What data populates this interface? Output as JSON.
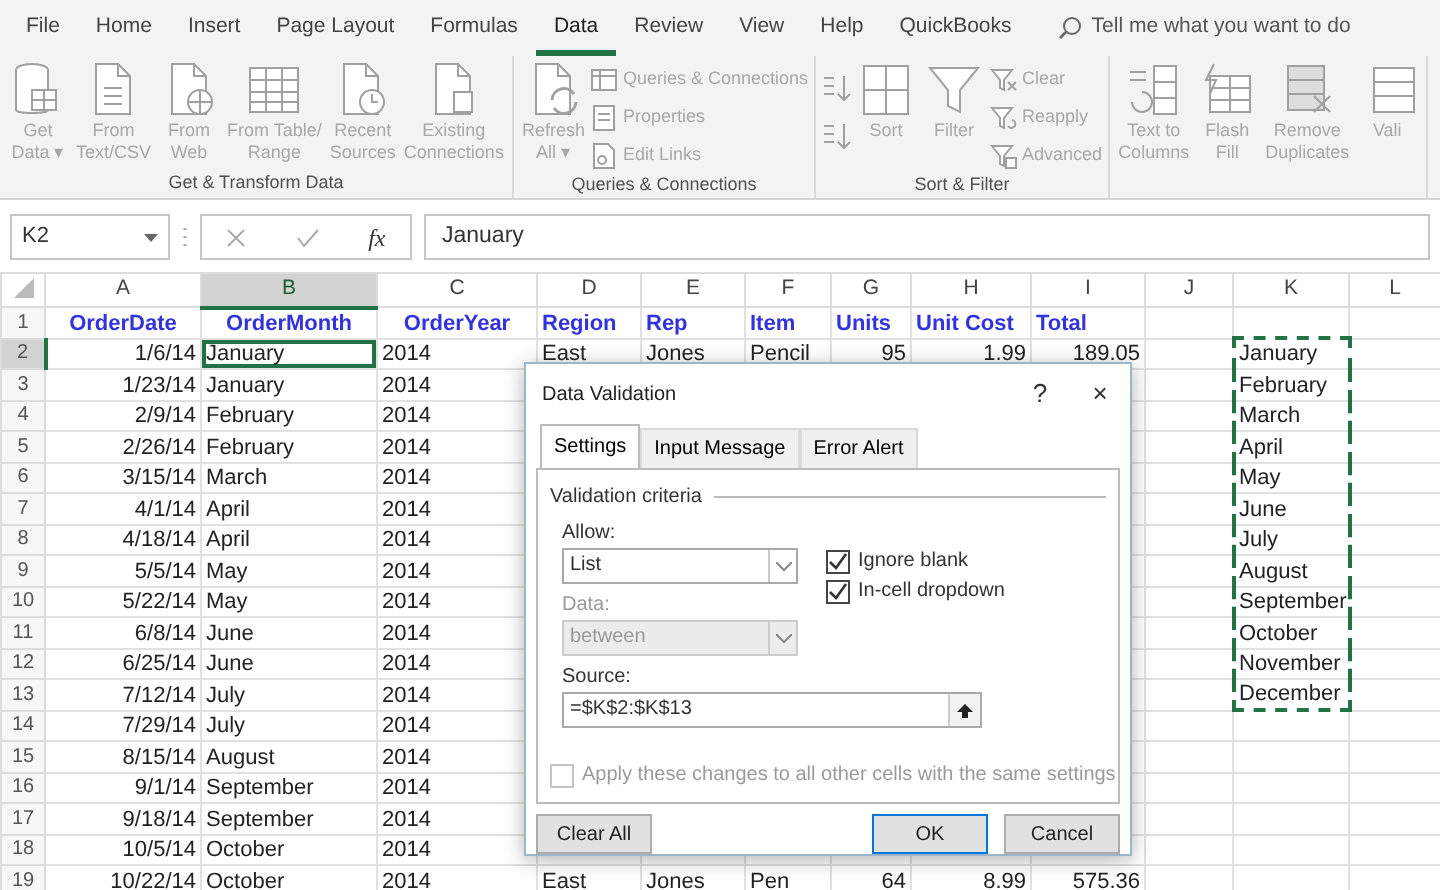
{
  "ribbon_tabs": [
    {
      "label": "File",
      "selected": false
    },
    {
      "label": "Home",
      "selected": false
    },
    {
      "label": "Insert",
      "selected": false
    },
    {
      "label": "Page Layout",
      "selected": false
    },
    {
      "label": "Formulas",
      "selected": false
    },
    {
      "label": "Data",
      "selected": true
    },
    {
      "label": "Review",
      "selected": false
    },
    {
      "label": "View",
      "selected": false
    },
    {
      "label": "Help",
      "selected": false
    },
    {
      "label": "QuickBooks",
      "selected": false
    }
  ],
  "tell_me": {
    "placeholder": "Tell me what you want to do"
  },
  "ribbon": {
    "disabled": true,
    "groups": [
      {
        "label": "Get & Transform Data",
        "items": [
          {
            "kind": "large",
            "lines": [
              "Get",
              "Data ▾"
            ]
          },
          {
            "kind": "large",
            "lines": [
              "From",
              "Text/CSV"
            ]
          },
          {
            "kind": "large",
            "lines": [
              "From",
              "Web"
            ]
          },
          {
            "kind": "large",
            "lines": [
              "From Table/",
              "Range"
            ]
          },
          {
            "kind": "large",
            "lines": [
              "Recent",
              "Sources"
            ]
          },
          {
            "kind": "large",
            "lines": [
              "Existing",
              "Connections"
            ]
          }
        ]
      },
      {
        "items": [
          {
            "kind": "large",
            "lines": [
              "Refresh",
              "All ▾"
            ]
          },
          {
            "kind": "small",
            "label": "Queries & Connections"
          },
          {
            "kind": "small",
            "label": "Properties"
          },
          {
            "kind": "small",
            "label": "Edit Links"
          }
        ],
        "label": "Queries & Connections"
      },
      {
        "label": "Sort & Filter",
        "items": [
          {
            "kind": "sort_icons"
          },
          {
            "kind": "large",
            "lines": [
              "Sort"
            ]
          },
          {
            "kind": "large",
            "lines": [
              "Filter"
            ]
          },
          {
            "kind": "small",
            "label": "Clear"
          },
          {
            "kind": "small",
            "label": "Reapply"
          },
          {
            "kind": "small",
            "label": "Advanced"
          }
        ]
      },
      {
        "items": [
          {
            "kind": "large",
            "lines": [
              "Text to",
              "Columns"
            ]
          },
          {
            "kind": "large",
            "lines": [
              "Flash",
              "Fill"
            ]
          },
          {
            "kind": "large",
            "lines": [
              "Remove",
              "Duplicates"
            ]
          },
          {
            "kind": "large",
            "lines": [
              "Vali"
            ]
          }
        ]
      }
    ]
  },
  "formula_bar": {
    "name_box": "K2",
    "function_label": "fx",
    "value": "January"
  },
  "columns": [
    {
      "letter": "A",
      "selected": false
    },
    {
      "letter": "B",
      "selected": true
    },
    {
      "letter": "C",
      "selected": false
    },
    {
      "letter": "D",
      "selected": false
    },
    {
      "letter": "E",
      "selected": false
    },
    {
      "letter": "F",
      "selected": false
    },
    {
      "letter": "G",
      "selected": false
    },
    {
      "letter": "H",
      "selected": false
    },
    {
      "letter": "I",
      "selected": false
    },
    {
      "letter": "J",
      "selected": false
    },
    {
      "letter": "K",
      "selected": false
    },
    {
      "letter": "L",
      "selected": false
    }
  ],
  "rows": [
    {
      "header": "1",
      "kind": "header",
      "selected": false,
      "in_copied_range": false,
      "cells": {
        "A": "OrderDate",
        "B": "OrderMonth",
        "C": "OrderYear",
        "D": "Region",
        "E": "Rep",
        "F": "Item",
        "G": "Units",
        "H": "Unit Cost",
        "I": "Total"
      }
    },
    {
      "header": "2",
      "kind": "data",
      "selected": true,
      "in_copied_range": true,
      "cells": {
        "A": "1/6/14",
        "B": "January",
        "C": "2014",
        "D": "East",
        "E": "Jones",
        "F": "Pencil",
        "G": "95",
        "H": "1.99",
        "I": "189.05",
        "K": "January"
      }
    },
    {
      "header": "3",
      "kind": "data",
      "selected": false,
      "in_copied_range": true,
      "cells": {
        "A": "1/23/14",
        "B": "January",
        "C": "2014",
        "K": "February"
      }
    },
    {
      "header": "4",
      "kind": "data",
      "selected": false,
      "in_copied_range": true,
      "cells": {
        "A": "2/9/14",
        "B": "February",
        "C": "2014",
        "K": "March"
      }
    },
    {
      "header": "5",
      "kind": "data",
      "selected": false,
      "in_copied_range": true,
      "cells": {
        "A": "2/26/14",
        "B": "February",
        "C": "2014",
        "K": "April"
      }
    },
    {
      "header": "6",
      "kind": "data",
      "selected": false,
      "in_copied_range": true,
      "cells": {
        "A": "3/15/14",
        "B": "March",
        "C": "2014",
        "K": "May"
      }
    },
    {
      "header": "7",
      "kind": "data",
      "selected": false,
      "in_copied_range": true,
      "cells": {
        "A": "4/1/14",
        "B": "April",
        "C": "2014",
        "K": "June"
      }
    },
    {
      "header": "8",
      "kind": "data",
      "selected": false,
      "in_copied_range": true,
      "cells": {
        "A": "4/18/14",
        "B": "April",
        "C": "2014",
        "K": "July"
      }
    },
    {
      "header": "9",
      "kind": "data",
      "selected": false,
      "in_copied_range": true,
      "cells": {
        "A": "5/5/14",
        "B": "May",
        "C": "2014",
        "K": "August"
      }
    },
    {
      "header": "10",
      "kind": "data",
      "selected": false,
      "in_copied_range": true,
      "cells": {
        "A": "5/22/14",
        "B": "May",
        "C": "2014",
        "K": "September"
      }
    },
    {
      "header": "11",
      "kind": "data",
      "selected": false,
      "in_copied_range": true,
      "cells": {
        "A": "6/8/14",
        "B": "June",
        "C": "2014",
        "K": "October"
      }
    },
    {
      "header": "12",
      "kind": "data",
      "selected": false,
      "in_copied_range": true,
      "cells": {
        "A": "6/25/14",
        "B": "June",
        "C": "2014",
        "K": "November"
      }
    },
    {
      "header": "13",
      "kind": "data",
      "selected": false,
      "in_copied_range": true,
      "cells": {
        "A": "7/12/14",
        "B": "July",
        "C": "2014",
        "K": "December"
      }
    },
    {
      "header": "14",
      "kind": "data",
      "selected": false,
      "in_copied_range": false,
      "cells": {
        "A": "7/29/14",
        "B": "July",
        "C": "2014"
      }
    },
    {
      "header": "15",
      "kind": "data",
      "selected": false,
      "in_copied_range": false,
      "cells": {
        "A": "8/15/14",
        "B": "August",
        "C": "2014"
      }
    },
    {
      "header": "16",
      "kind": "data",
      "selected": false,
      "in_copied_range": false,
      "cells": {
        "A": "9/1/14",
        "B": "September",
        "C": "2014"
      }
    },
    {
      "header": "17",
      "kind": "data",
      "selected": false,
      "in_copied_range": false,
      "cells": {
        "A": "9/18/14",
        "B": "September",
        "C": "2014"
      }
    },
    {
      "header": "18",
      "kind": "data",
      "selected": false,
      "in_copied_range": false,
      "cells": {
        "A": "10/5/14",
        "B": "October",
        "C": "2014"
      }
    },
    {
      "header": "19",
      "kind": "data",
      "selected": false,
      "in_copied_range": false,
      "cells": {
        "A": "10/22/14",
        "B": "October",
        "C": "2014",
        "D": "East",
        "E": "Jones",
        "F": "Pen",
        "G": "64",
        "H": "8.99",
        "I": "575.36"
      }
    }
  ],
  "dialog": {
    "title": "Data Validation",
    "help_label": "?",
    "close_label": "×",
    "tabs": [
      {
        "label": "Settings",
        "selected": true
      },
      {
        "label": "Input Message",
        "selected": false
      },
      {
        "label": "Error Alert",
        "selected": false
      }
    ],
    "section_title": "Validation criteria",
    "allow": {
      "label": "Allow:",
      "value": "List",
      "disabled": false
    },
    "data": {
      "label": "Data:",
      "value": "between",
      "disabled": true
    },
    "checkboxes": [
      {
        "label": "Ignore blank",
        "checked": true,
        "disabled": false
      },
      {
        "label": "In-cell dropdown",
        "checked": true,
        "disabled": false
      }
    ],
    "source": {
      "label": "Source:",
      "value": "=$K$2:$K$13"
    },
    "apply_all": {
      "label": "Apply these changes to all other cells with the same settings",
      "checked": false,
      "disabled": true
    },
    "buttons": [
      {
        "label": "Clear All",
        "default": false
      },
      {
        "label": "OK",
        "default": true
      },
      {
        "label": "Cancel",
        "default": false
      }
    ]
  }
}
